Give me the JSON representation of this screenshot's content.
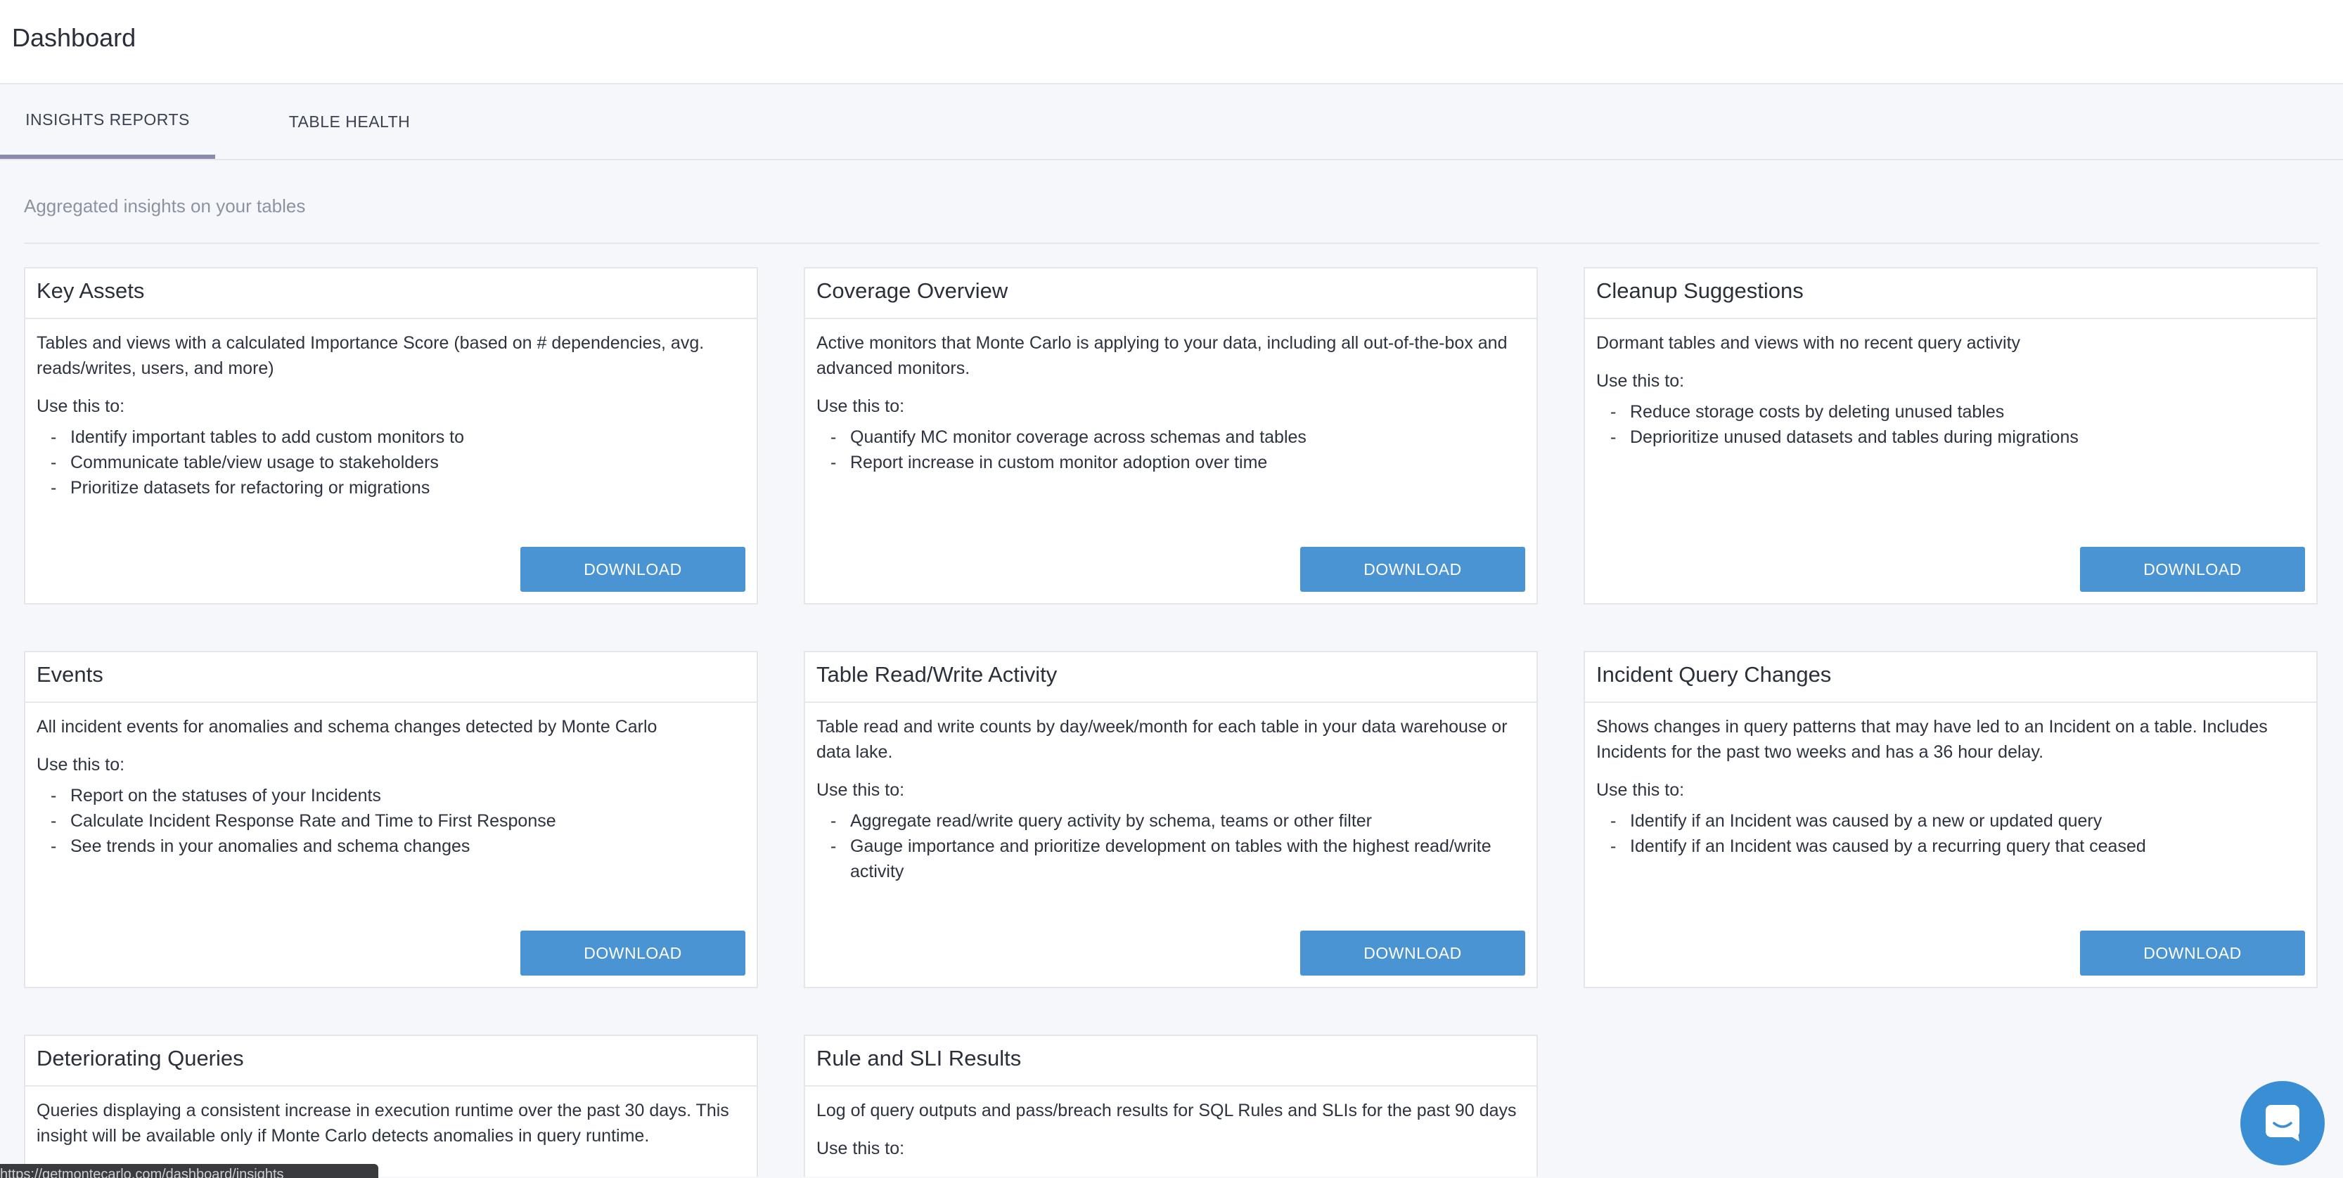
{
  "page": {
    "title": "Dashboard"
  },
  "tabs": [
    {
      "label": "INSIGHTS REPORTS",
      "active": true
    },
    {
      "label": "TABLE HEALTH",
      "active": false
    }
  ],
  "subtitle": "Aggregated insights on your tables",
  "use_label": "Use this to:",
  "download_label": "DOWNLOAD",
  "cards": [
    {
      "title": "Key Assets",
      "description": "Tables and views with a calculated Importance Score (based on # dependencies, avg. reads/writes, users, and more)",
      "bullets": [
        "Identify important tables to add custom monitors to",
        "Communicate table/view usage to stakeholders",
        "Prioritize datasets for refactoring or migrations"
      ]
    },
    {
      "title": "Coverage Overview",
      "description": "Active monitors that Monte Carlo is applying to your data, including all out-of-the-box and advanced monitors.",
      "bullets": [
        "Quantify MC monitor coverage across schemas and tables",
        "Report increase in custom monitor adoption over time"
      ]
    },
    {
      "title": "Cleanup Suggestions",
      "description": "Dormant tables and views with no recent query activity",
      "bullets": [
        "Reduce storage costs by deleting unused tables",
        "Deprioritize unused datasets and tables during migrations"
      ]
    },
    {
      "title": "Events",
      "description": "All incident events for anomalies and schema changes detected by Monte Carlo",
      "bullets": [
        "Report on the statuses of your Incidents",
        "Calculate Incident Response Rate and Time to First Response",
        "See trends in your anomalies and schema changes"
      ]
    },
    {
      "title": "Table Read/Write Activity",
      "description": "Table read and write counts by day/week/month for each table in your data warehouse or data lake.",
      "bullets": [
        "Aggregate read/write query activity by schema, teams or other filter",
        "Gauge importance and prioritize development on tables with the highest read/write activity"
      ]
    },
    {
      "title": "Incident Query Changes",
      "description": "Shows changes in query patterns that may have led to an Incident on a table. Includes Incidents for the past two weeks and has a 36 hour delay.",
      "bullets": [
        "Identify if an Incident was caused by a new or updated query",
        "Identify if an Incident was caused by a recurring query that ceased"
      ]
    },
    {
      "title": "Deteriorating Queries",
      "description": "Queries displaying a consistent increase in execution runtime over the past 30 days. This insight will be available only if Monte Carlo detects anomalies in query runtime.",
      "bullets": []
    },
    {
      "title": "Rule and SLI Results",
      "description": "Log of query outputs and pass/breach results for SQL Rules and SLIs for the past 90 days",
      "bullets": []
    }
  ],
  "status_bar": {
    "url": "https://getmontecarlo.com/dashboard/insights"
  },
  "colors": {
    "accent": "#4a94d3",
    "tab_indicator": "#8a8cae",
    "background": "#f6f7fa"
  },
  "chat": {
    "icon": "chat-icon"
  }
}
